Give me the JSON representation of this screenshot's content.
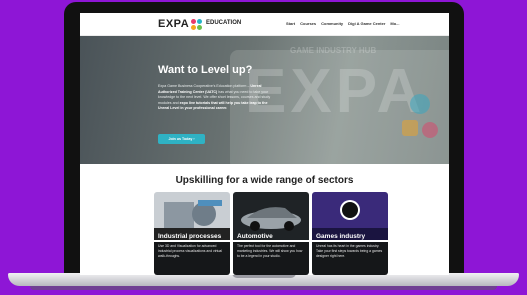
{
  "nav": {
    "logo_text": "EXPA",
    "section": "EDUCATION",
    "menu": [
      "Start",
      "Courses",
      "Community",
      "Digi A Game Center",
      "Mo..."
    ]
  },
  "hero": {
    "title": "Want to Level up?",
    "body_part1": "Expa Game Business Cooperative's Education platform – ",
    "body_bold1": "Unreal Authorized Training Center (UATC)",
    "body_part2": " has what you need to take your knowledge to the next level. We offer short lessons, courses and study modules and ",
    "body_bold2": "expo live tutorials that will help you take leap to the Unreal Level in your professional career.",
    "backdrop_logo": "EXPA",
    "backdrop_caption": "GAME INDUSTRY HUB",
    "cta_label": "Join us Today  ›"
  },
  "section": {
    "title": "Upskilling for a wide range of sectors",
    "cards": [
      {
        "label": "Industrial processes",
        "desc": "Use 3D and Visualization for advanced industrial process visualizations and virtual walk-throughs."
      },
      {
        "label": "Automotive",
        "desc": "The perfect tool for the automotive and marketing industries. We will show you how to be a legend in your studio."
      },
      {
        "label": "Games industry",
        "desc": "Unreal has its heart in the games industry. Take your first steps towards being a games designer right here."
      }
    ]
  },
  "colors": {
    "background": "#8e16d6",
    "cta": "#2fb2c4",
    "logo_dots": [
      "#e83a6a",
      "#25b4c8",
      "#f5a51c",
      "#6bbf4a"
    ]
  }
}
